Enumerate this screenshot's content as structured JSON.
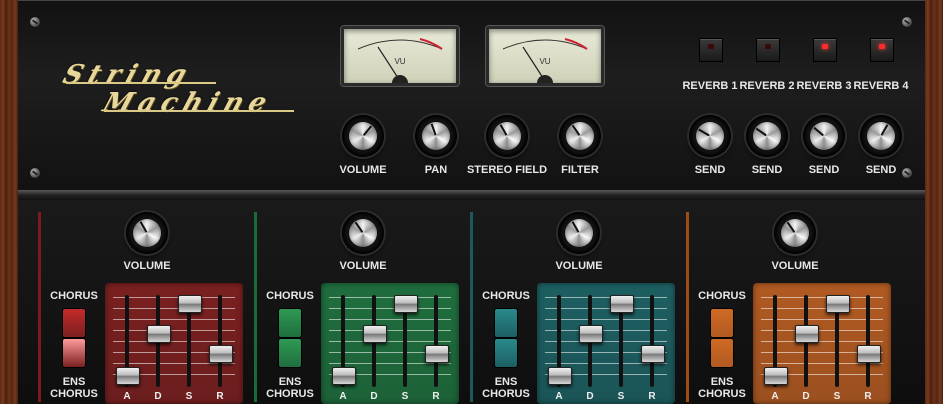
{
  "header": {
    "logo_line1": "String",
    "logo_line2": "Machine",
    "vu_left_label": "VU",
    "vu_right_label": "VU",
    "main_knobs": [
      {
        "label": "VOLUME"
      },
      {
        "label": "PAN"
      },
      {
        "label": "STEREO FIELD"
      },
      {
        "label": "FILTER"
      }
    ],
    "reverbs": [
      {
        "label": "REVERB 1",
        "active": false,
        "send_label": "SEND"
      },
      {
        "label": "REVERB 2",
        "active": false,
        "send_label": "SEND"
      },
      {
        "label": "REVERB 3",
        "active": true,
        "send_label": "SEND"
      },
      {
        "label": "REVERB 4",
        "active": true,
        "send_label": "SEND"
      }
    ]
  },
  "sections": [
    {
      "accent": "#7a1c1c",
      "box_color": "#7a2020",
      "button_color": "#c42a2a",
      "volume_label": "VOLUME",
      "chorus_label": "CHORUS",
      "ens_label_1": "ENS",
      "ens_label_2": "CHORUS",
      "adsr": {
        "A": "A",
        "D": "D",
        "S": "S",
        "R": "R"
      }
    },
    {
      "accent": "#1a6a3a",
      "box_color": "#1f6e3e",
      "button_color": "#2f9a54",
      "volume_label": "VOLUME",
      "chorus_label": "CHORUS",
      "ens_label_1": "ENS",
      "ens_label_2": "CHORUS",
      "adsr": {
        "A": "A",
        "D": "D",
        "S": "S",
        "R": "R"
      }
    },
    {
      "accent": "#1a5a5a",
      "box_color": "#1d5f62",
      "button_color": "#2a8a8c",
      "volume_label": "VOLUME",
      "chorus_label": "CHORUS",
      "ens_label_1": "ENS",
      "ens_label_2": "CHORUS",
      "adsr": {
        "A": "A",
        "D": "D",
        "S": "S",
        "R": "R"
      }
    },
    {
      "accent": "#a04a1a",
      "box_color": "#b15a22",
      "button_color": "#d06a24",
      "volume_label": "VOLUME",
      "chorus_label": "CHORUS",
      "ens_label_1": "ENS",
      "ens_label_2": "CHORUS",
      "adsr": {
        "A": "A",
        "D": "D",
        "S": "S",
        "R": "R"
      }
    }
  ]
}
